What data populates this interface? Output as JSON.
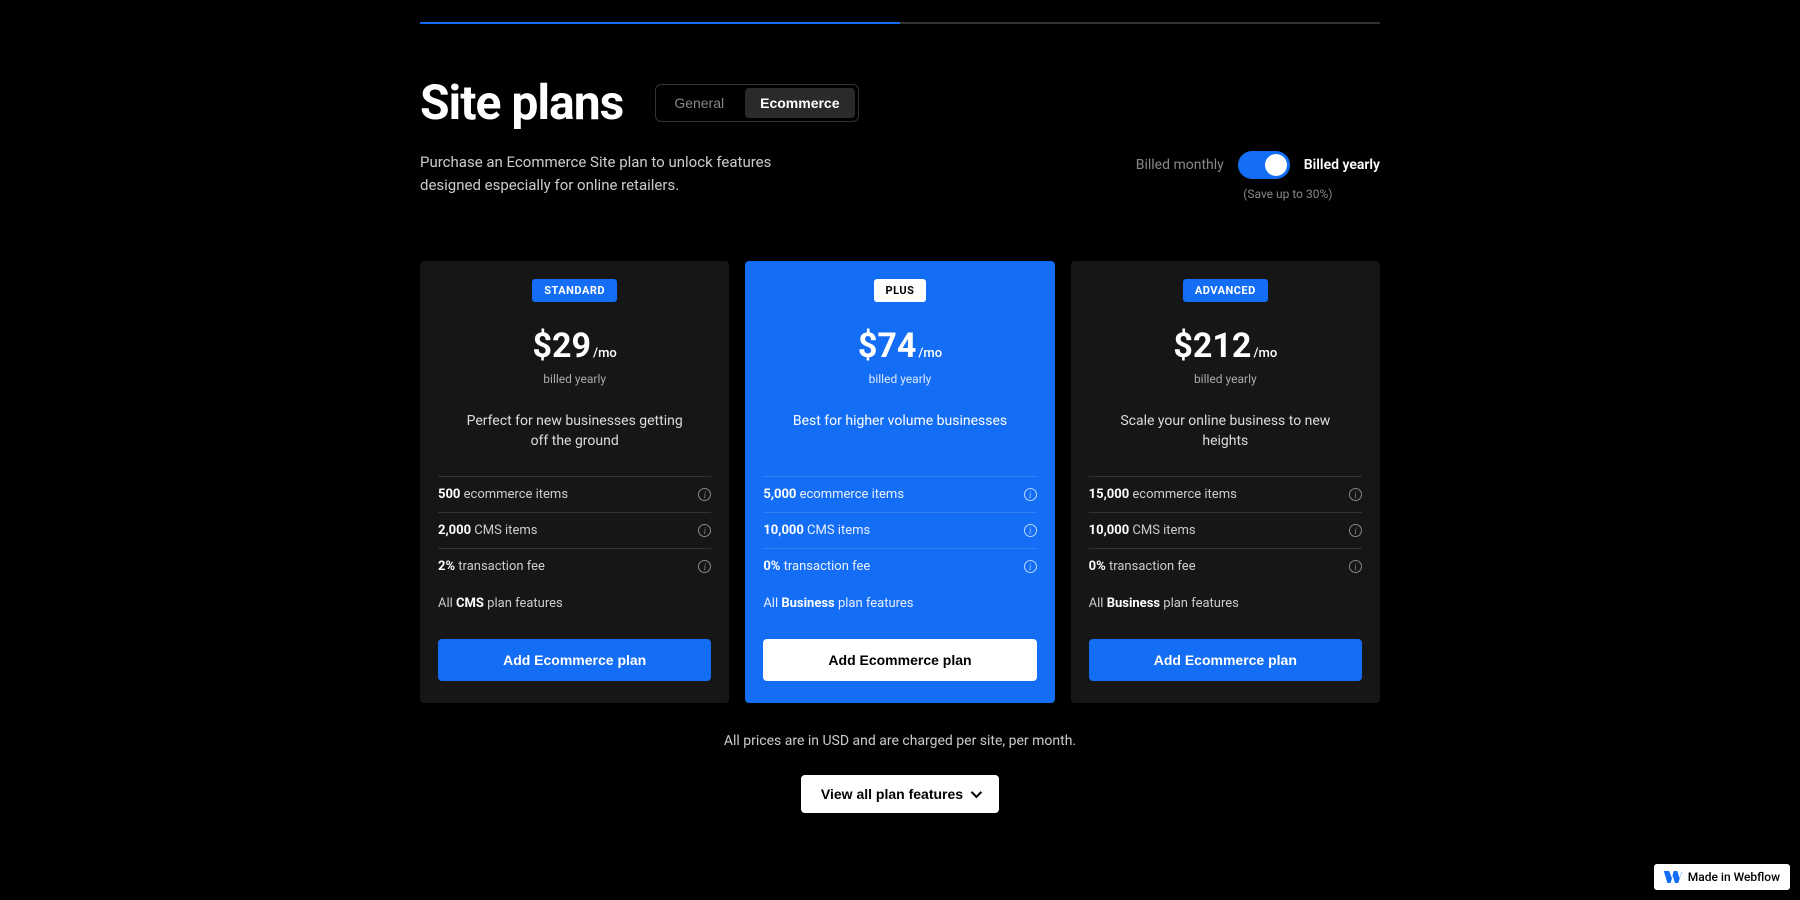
{
  "page": {
    "title": "Site plans",
    "subtitle": "Purchase an Ecommerce Site plan to unlock features designed especially for online retailers.",
    "tabs": {
      "general": "General",
      "ecommerce": "Ecommerce"
    }
  },
  "billing": {
    "monthly_label": "Billed monthly",
    "yearly_label": "Billed yearly",
    "save_note": "(Save up to 30%)"
  },
  "plans": [
    {
      "badge": "STANDARD",
      "price": "$29",
      "unit": "/mo",
      "billed": "billed yearly",
      "tagline": "Perfect for new businesses getting off the ground",
      "features": [
        {
          "bold": "500",
          "rest": " ecommerce items",
          "info": true
        },
        {
          "bold": "2,000",
          "rest": " CMS items",
          "info": true
        },
        {
          "bold": "2%",
          "rest": " transaction fee",
          "info": true
        }
      ],
      "summary_pre": "All ",
      "summary_bold": "CMS",
      "summary_post": " plan features",
      "cta": "Add Ecommerce plan"
    },
    {
      "badge": "PLUS",
      "price": "$74",
      "unit": "/mo",
      "billed": "billed yearly",
      "tagline": "Best for higher volume businesses",
      "features": [
        {
          "bold": "5,000",
          "rest": " ecommerce items",
          "info": true
        },
        {
          "bold": "10,000",
          "rest": " CMS items",
          "info": true
        },
        {
          "bold": "0%",
          "rest": " transaction fee",
          "info": true
        }
      ],
      "summary_pre": "All ",
      "summary_bold": "Business",
      "summary_post": " plan features",
      "cta": "Add Ecommerce plan"
    },
    {
      "badge": "ADVANCED",
      "price": "$212",
      "unit": "/mo",
      "billed": "billed yearly",
      "tagline": "Scale your online business to new heights",
      "features": [
        {
          "bold": "15,000",
          "rest": " ecommerce items",
          "info": true
        },
        {
          "bold": "10,000",
          "rest": " CMS items",
          "info": true
        },
        {
          "bold": "0%",
          "rest": " transaction fee",
          "info": true
        }
      ],
      "summary_pre": "All ",
      "summary_bold": "Business",
      "summary_post": " plan features",
      "cta": "Add Ecommerce plan"
    }
  ],
  "footnote": "All prices are in USD and are charged per site, per month.",
  "view_all": "View all plan features",
  "webflow_badge": "Made in Webflow"
}
